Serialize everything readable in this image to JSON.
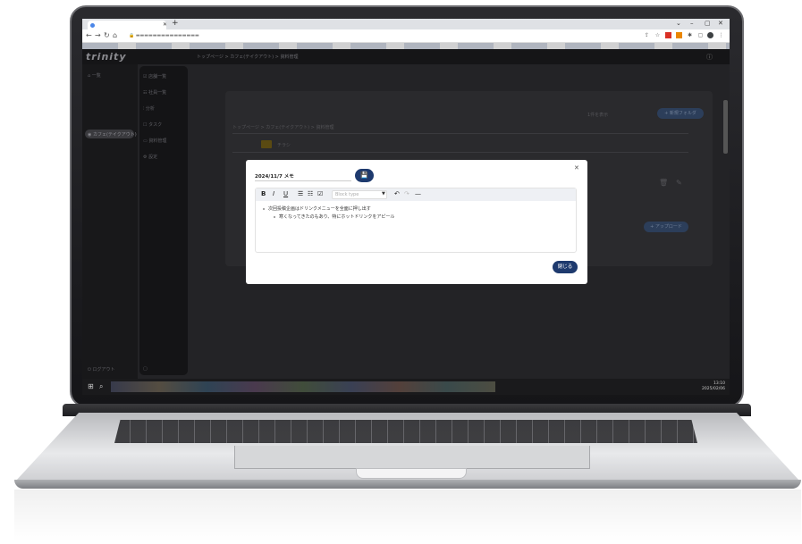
{
  "browser": {
    "window_controls": [
      "⌄",
      "–",
      "▢",
      "✕"
    ]
  },
  "app": {
    "logo": "trinity",
    "breadcrumb": "トップページ > カフェ(テイクアウト) > 資料管理",
    "sidebar_primary": [
      {
        "label": "一覧"
      },
      {
        "label": "カフェ(テイクアウト)"
      }
    ],
    "sidebar_secondary": [
      {
        "label": "店舗一覧"
      },
      {
        "label": "社員一覧"
      },
      {
        "label": "分析"
      },
      {
        "label": "タスク"
      },
      {
        "label": "資料管理"
      },
      {
        "label": "設定"
      }
    ],
    "sidebar_bottom": {
      "label": "ログアウト"
    },
    "main": {
      "folder_label": "チラシ",
      "right_label": "1件を表示",
      "top_button": "+ 新規フォルダ",
      "bottom_button": "+ アップロード"
    }
  },
  "modal": {
    "title": "2024/11/7 メモ",
    "save_icon": "💾",
    "block_type_placeholder": "Block type",
    "toolbar": [
      "B",
      "I",
      "U"
    ],
    "bullets": [
      {
        "text": "次回投稿企画はドリンクメニューを全面に押し出す",
        "level": 0
      },
      {
        "text": "寒くなってきたのもあり、特にホットドリンクをアピール",
        "level": 1
      }
    ],
    "close_button": "閉じる"
  },
  "taskbar": {
    "time": "13:10",
    "date": "2025/02/06"
  }
}
